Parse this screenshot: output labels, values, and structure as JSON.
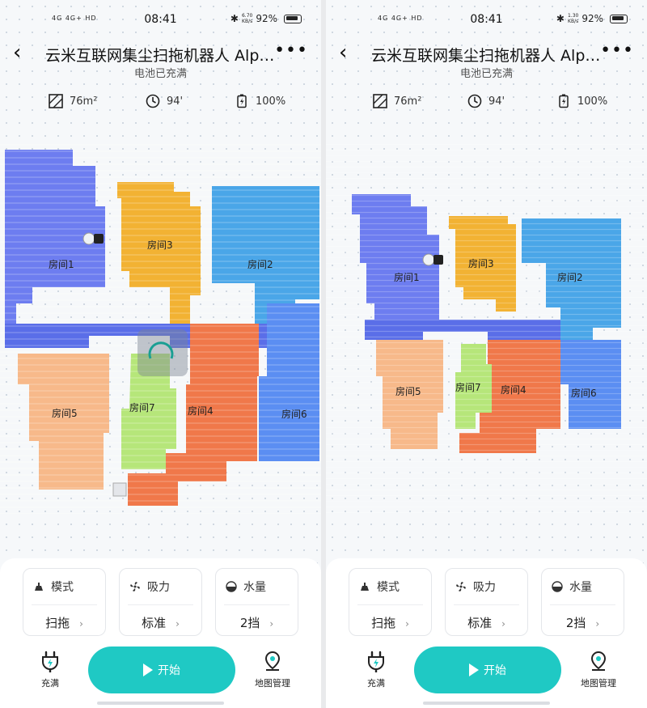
{
  "colors": {
    "accent": "#1fc9c4",
    "room1": "#6d7df0",
    "room2": "#4aa6e8",
    "room3": "#f2b233",
    "room4": "#f0784a",
    "room5": "#f7b98a",
    "room6": "#5b8ef2",
    "room7": "#b6e67a",
    "corridor": "#5a6ee8"
  },
  "screens": [
    {
      "status": {
        "network": "4G 4G+ HD",
        "time": "08:41",
        "speed_value": "6.70",
        "speed_unit": "KB/s",
        "battery": "92%"
      },
      "header": {
        "title": "云米互联网集尘扫拖机器人 Alph…",
        "subtitle": "电池已充满"
      },
      "stats": {
        "area": "76m²",
        "time": "94'",
        "battery": "100%"
      },
      "rooms": [
        "房间1",
        "房间2",
        "房间3",
        "房间4",
        "房间5",
        "房间6",
        "房间7"
      ],
      "controls": {
        "mode": {
          "label": "模式",
          "value": "扫拖"
        },
        "suction": {
          "label": "吸力",
          "value": "标准"
        },
        "water": {
          "label": "水量",
          "value": "2挡"
        }
      },
      "bottom": {
        "charge_label": "充满",
        "start_label": "开始",
        "map_label": "地图管理"
      }
    },
    {
      "status": {
        "network": "4G 4G+ HD",
        "time": "08:41",
        "speed_value": "1.30",
        "speed_unit": "KB/s",
        "battery": "92%"
      },
      "header": {
        "title": "云米互联网集尘扫拖机器人 Alph…",
        "subtitle": "电池已充满"
      },
      "stats": {
        "area": "76m²",
        "time": "94'",
        "battery": "100%"
      },
      "rooms": [
        "房间1",
        "房间2",
        "房间3",
        "房间4",
        "房间5",
        "房间6",
        "房间7"
      ],
      "controls": {
        "mode": {
          "label": "模式",
          "value": "扫拖"
        },
        "suction": {
          "label": "吸力",
          "value": "标准"
        },
        "water": {
          "label": "水量",
          "value": "2挡"
        }
      },
      "bottom": {
        "charge_label": "充满",
        "start_label": "开始",
        "map_label": "地图管理"
      }
    }
  ]
}
